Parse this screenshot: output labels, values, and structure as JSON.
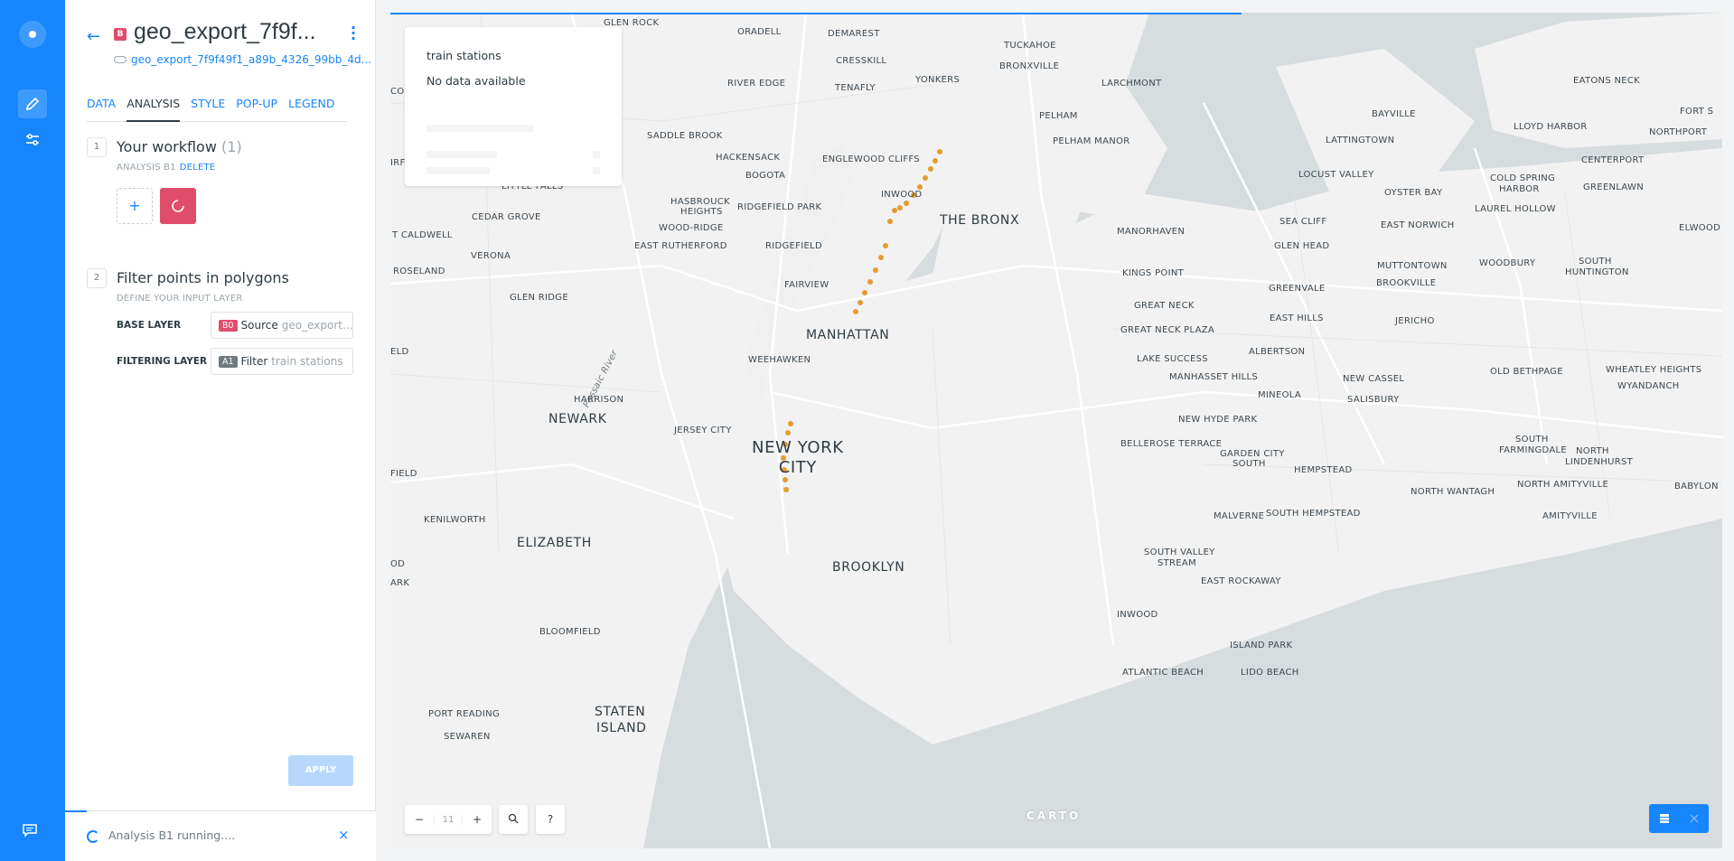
{
  "panel": {
    "layer_badge": "B",
    "layer_title": "geo_export_7f9f...",
    "source_link": "geo_export_7f9f49f1_a89b_4326_99bb_4d...",
    "tabs": [
      "DATA",
      "ANALYSIS",
      "STYLE",
      "POP-UP",
      "LEGEND"
    ],
    "active_tab": "ANALYSIS",
    "step1": {
      "num": "1",
      "title": "Your workflow",
      "count": "(1)",
      "sub": "ANALYSIS B1",
      "delete": "DELETE"
    },
    "step2": {
      "num": "2",
      "title": "Filter points in polygons",
      "sub": "DEFINE YOUR INPUT LAYER"
    },
    "base_layer": {
      "label": "BASE LAYER",
      "chip": "B0",
      "chip_color": "#e04d6a",
      "name": "Source",
      "value": "geo_export..."
    },
    "filtering_layer": {
      "label": "FILTERING LAYER",
      "chip": "A1",
      "chip_color": "#6f7a80",
      "name": "Filter",
      "value": "train stations"
    },
    "apply_label": "APPLY",
    "add_label": "+",
    "notification": "Analysis B1 running....",
    "close_label": "×"
  },
  "legend": {
    "title": "train stations",
    "no_data": "No data available"
  },
  "map": {
    "zoom_level": "11",
    "zoom_out": "−",
    "zoom_in": "+",
    "help": "?",
    "attribution": "CARTO",
    "labels": {
      "glen_rock": "GLEN ROCK",
      "oradell": "ORADELL",
      "demarest": "DEMAREST",
      "cresskill": "CRESSKILL",
      "tuckahoe": "TUCKAHOE",
      "bronxville": "BRONXVILLE",
      "larchmont": "LARCHMONT",
      "yonkers": "YONKERS",
      "river_edge": "RIVER EDGE",
      "tenafly": "TENAFLY",
      "pelham": "PELHAM",
      "pelham_manor": "PELHAM MANOR",
      "saddle_brook": "SADDLE BROOK",
      "hackensack": "HACKENSACK",
      "bogota": "BOGOTA",
      "englewood_cliffs": "ENGLEWOOD CLIFFS",
      "little_falls": "LITTLE FALLS",
      "inwood": "INWOOD",
      "hasbrouck": "HASBROUCK",
      "heights": "HEIGHTS",
      "ridgefield_park": "RIDGEFIELD PARK",
      "the_bronx": "THE BRONX",
      "cedar_grove": "CEDAR GROVE",
      "wood_ridge": "WOOD-RIDGE",
      "west_caldwell": "T CALDWELL",
      "east_rutherford": "EAST RUTHERFORD",
      "ridgefield": "RIDGEFIELD",
      "verona": "VERONA",
      "roseland": "ROSELAND",
      "fairview": "FAIRVIEW",
      "glen_ridge": "GLEN RIDGE",
      "manhattan": "MANHATTAN",
      "weehawken": "WEEHAWKEN",
      "harrison": "HARRISON",
      "newark": "NEWARK",
      "jersey_city": "JERSEY CITY",
      "nyc_1": "NEW YORK",
      "nyc_2": "CITY",
      "elizabeth": "ELIZABETH",
      "kenilworth": "KENILWORTH",
      "brooklyn": "BROOKLYN",
      "bloomfield": "BLOOMFIELD",
      "port_reading": "PORT READING",
      "sewaren": "SEWAREN",
      "staten_1": "STATEN",
      "staten_2": "ISLAND",
      "passaic_river": "Passaic River",
      "manorhaven": "MANORHAVEN",
      "kings_point": "KINGS POINT",
      "great_neck": "GREAT NECK",
      "great_neck_plaza": "GREAT NECK PLAZA",
      "lake_success": "LAKE SUCCESS",
      "manhasset_hills": "MANHASSET HILLS",
      "new_hyde_park": "NEW HYDE PARK",
      "bellerose_terrace": "BELLEROSE TERRACE",
      "garden_city_1": "GARDEN CITY",
      "garden_city_2": "SOUTH",
      "malverne": "MALVERNE",
      "south_hempstead": "SOUTH HEMPSTEAD",
      "south_valley_1": "SOUTH VALLEY",
      "south_valley_2": "STREAM",
      "east_rockaway": "EAST ROCKAWAY",
      "inwood_li": "INWOOD",
      "island_park": "ISLAND PARK",
      "atlantic_beach": "ATLANTIC BEACH",
      "lido_beach": "LIDO BEACH",
      "sea_cliff": "SEA CLIFF",
      "glen_head": "GLEN HEAD",
      "greenvale": "GREENVALE",
      "east_hills": "EAST HILLS",
      "albertson": "ALBERTSON",
      "mineola": "MINEOLA",
      "new_cassel": "NEW CASSEL",
      "salisbury": "SALISBURY",
      "hempstead": "HEMPSTEAD",
      "bayville": "BAYVILLE",
      "lattingtown": "LATTINGTOWN",
      "locust_valley": "LOCUST VALLEY",
      "oyster_bay": "OYSTER BAY",
      "east_norwich": "EAST NORWICH",
      "muttontown": "MUTTONTOWN",
      "brookville": "BROOKVILLE",
      "jericho": "JERICHO",
      "woodbury": "WOODBURY",
      "cold_spring_1": "COLD SPRING",
      "cold_spring_2": "HARBOR",
      "laurel_hollow": "LAUREL HOLLOW",
      "lloyd_harbor": "LLOYD HARBOR",
      "centerport": "CENTERPORT",
      "greenlawn": "GREENLAWN",
      "eatons_neck": "EATONS NECK",
      "northport": "NORTHPORT",
      "fort_s": "FORT S",
      "elwood": "ELWOOD",
      "south_huntington_1": "SOUTH",
      "south_huntington_2": "HUNTINGTON",
      "old_bethpage": "OLD BETHPAGE",
      "wheatley": "WHEATLEY HEIGHTS",
      "wyandanch": "WYANDANCH",
      "south_farmingdale_1": "SOUTH",
      "south_farmingdale_2": "FARMINGDALE",
      "north_lindenhurst_1": "NORTH",
      "north_lindenhurst_2": "LINDENHURST",
      "north_wantagh": "NORTH WANTAGH",
      "north_amityville": "NORTH AMITYVILLE",
      "amityville": "AMITYVILLE",
      "babylon": "BABYLON",
      "edge_col": "COL",
      "edge_irf": "IRF",
      "edge_eld": "ELD",
      "edge_field": "FIELD",
      "edge_od": "OD",
      "edge_ark": "ARK"
    }
  }
}
